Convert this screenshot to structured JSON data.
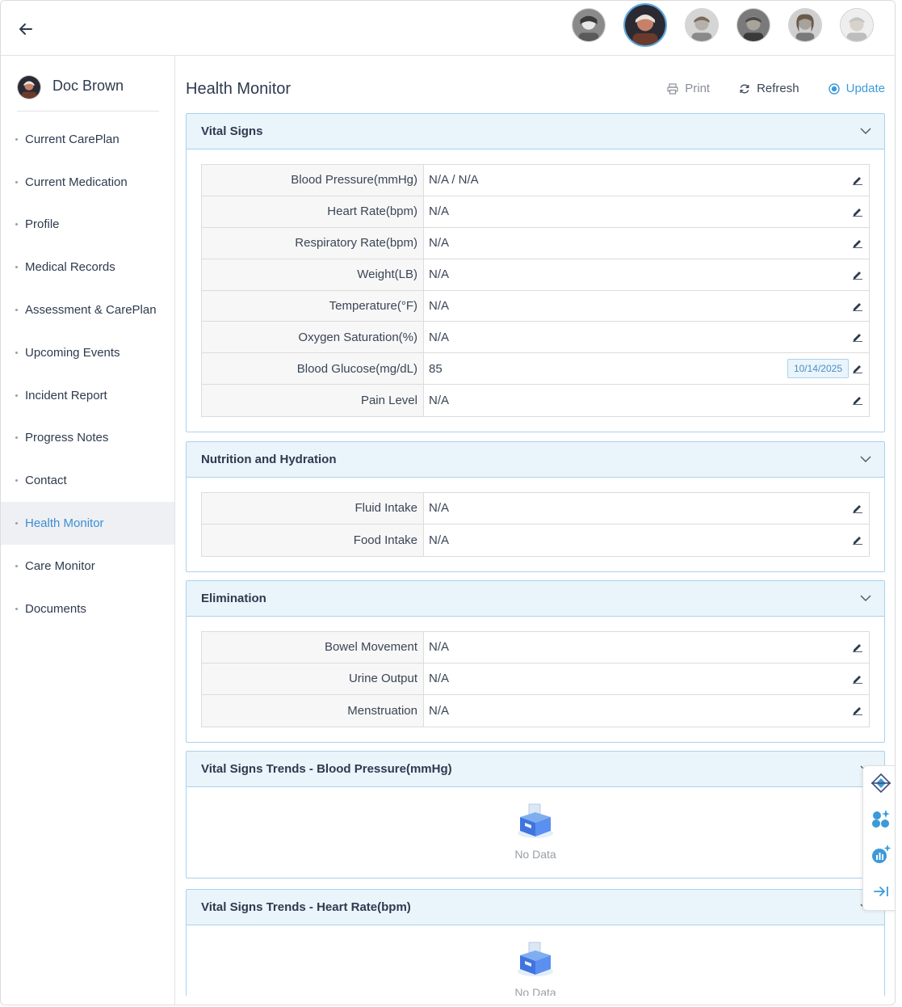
{
  "sidebar": {
    "user_name": "Doc Brown",
    "items": [
      {
        "label": "Current CarePlan",
        "active": false
      },
      {
        "label": "Current Medication",
        "active": false
      },
      {
        "label": "Profile",
        "active": false
      },
      {
        "label": "Medical Records",
        "active": false
      },
      {
        "label": "Assessment & CarePlan",
        "active": false
      },
      {
        "label": "Upcoming Events",
        "active": false
      },
      {
        "label": "Incident Report",
        "active": false
      },
      {
        "label": "Progress Notes",
        "active": false
      },
      {
        "label": "Contact",
        "active": false
      },
      {
        "label": "Health Monitor",
        "active": true
      },
      {
        "label": "Care Monitor",
        "active": false
      },
      {
        "label": "Documents",
        "active": false
      }
    ]
  },
  "header": {
    "title": "Health Monitor",
    "print": "Print",
    "refresh": "Refresh",
    "update": "Update"
  },
  "vital_signs": {
    "title": "Vital Signs",
    "rows": [
      {
        "label": "Blood Pressure(mmHg)",
        "value": "N/A / N/A"
      },
      {
        "label": "Heart Rate(bpm)",
        "value": "N/A"
      },
      {
        "label": "Respiratory Rate(bpm)",
        "value": "N/A"
      },
      {
        "label": "Weight(LB)",
        "value": "N/A"
      },
      {
        "label": "Temperature(°F)",
        "value": "N/A"
      },
      {
        "label": "Oxygen Saturation(%)",
        "value": "N/A"
      },
      {
        "label": "Blood Glucose(mg/dL)",
        "value": "85",
        "date": "10/14/2025"
      },
      {
        "label": "Pain Level",
        "value": "N/A"
      }
    ]
  },
  "nutrition": {
    "title": "Nutrition and Hydration",
    "rows": [
      {
        "label": "Fluid Intake",
        "value": "N/A"
      },
      {
        "label": "Food Intake",
        "value": "N/A"
      }
    ]
  },
  "elimination": {
    "title": "Elimination",
    "rows": [
      {
        "label": "Bowel Movement",
        "value": "N/A"
      },
      {
        "label": "Urine Output",
        "value": "N/A"
      },
      {
        "label": "Menstruation",
        "value": "N/A"
      }
    ]
  },
  "trends": [
    {
      "title": "Vital Signs Trends - Blood Pressure(mmHg)",
      "empty_text": "No Data"
    },
    {
      "title": "Vital Signs Trends - Heart Rate(bpm)",
      "empty_text": "No Data"
    }
  ],
  "colors": {
    "accent": "#3d9ad9",
    "panel_header_bg": "#eaf4fb",
    "panel_border": "#a9d2ee",
    "active_nav_bg": "#eef0f4"
  },
  "icons": {
    "back": "arrow-left-icon",
    "print": "printer-icon",
    "refresh": "refresh-icon",
    "update": "update-icon",
    "edit": "pencil-icon",
    "collapse": "chevron-down-icon",
    "empty": "empty-box-icon"
  }
}
